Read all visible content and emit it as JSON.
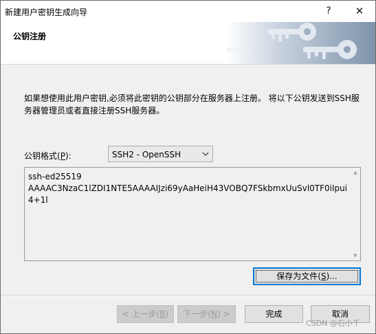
{
  "window": {
    "title": "新建用户密钥生成向导",
    "help_glyph": "?",
    "close_glyph": "✕"
  },
  "header": {
    "title": "公钥注册"
  },
  "description": "如果想使用此用户密钥,必须将此密钥的公钥部分在服务器上注册。 将以下公钥发送到SSH服务器管理员或者直接注册SSH服务器。",
  "format": {
    "label_prefix": "公钥格式(",
    "label_hotkey": "P",
    "label_suffix": "):",
    "selected": "SSH2 - OpenSSH"
  },
  "public_key": "ssh-ed25519\nAAAAC3NzaC1lZDI1NTE5AAAAIJzi69yAaHeiH43VOBQ7FSkbmxUuSvl0TF0iIpui4+1l",
  "scroll": {
    "up_glyph": "▲",
    "down_glyph": "▼"
  },
  "buttons": {
    "save_prefix": "保存为文件(",
    "save_hotkey": "S",
    "save_suffix": ")...",
    "back_prefix": "< 上一步(",
    "back_hotkey": "B",
    "back_suffix": ")",
    "next_prefix": "下一步(",
    "next_hotkey": "N",
    "next_suffix": ") >",
    "finish": "完成",
    "cancel": "取消"
  },
  "watermark": "CSDN @石小千",
  "colors": {
    "focus_border": "#0078d7",
    "dialog_background": "#f0f0f0",
    "disabled_text": "#9a9a9a"
  }
}
